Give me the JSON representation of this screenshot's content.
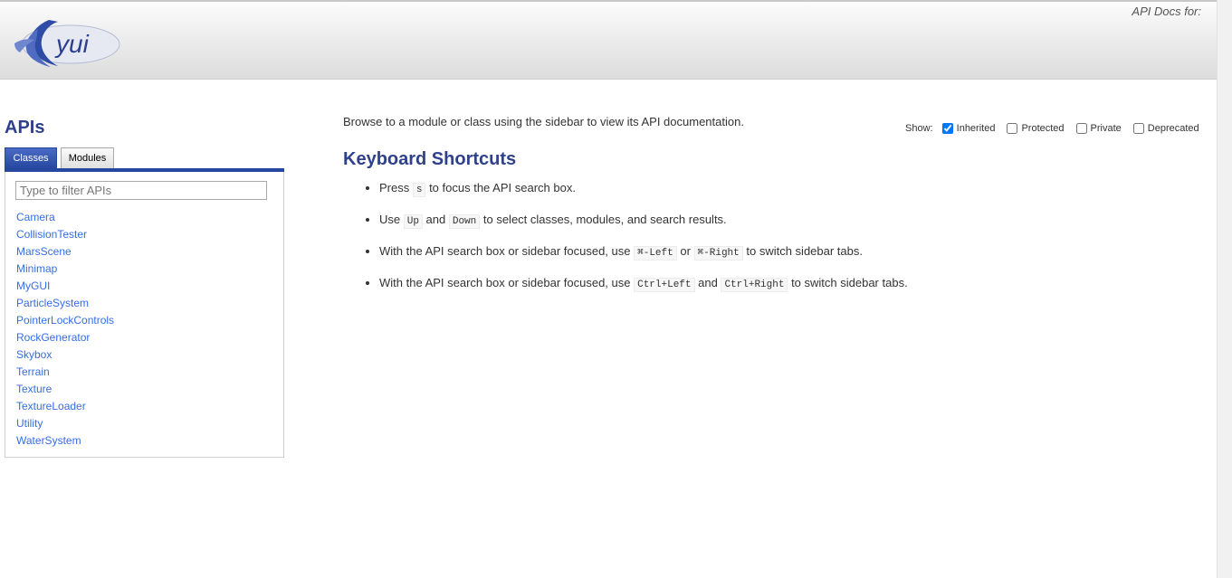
{
  "header": {
    "logo_text": "yui",
    "docs_label": "API Docs for:"
  },
  "sidebar": {
    "title": "APIs",
    "tabs": [
      {
        "label": "Classes",
        "active": true
      },
      {
        "label": "Modules",
        "active": false
      }
    ],
    "filter_placeholder": "Type to filter APIs",
    "classes": [
      "Camera",
      "CollisionTester",
      "MarsScene",
      "Minimap",
      "MyGUI",
      "ParticleSystem",
      "PointerLockControls",
      "RockGenerator",
      "Skybox",
      "Terrain",
      "Texture",
      "TextureLoader",
      "Utility",
      "WaterSystem"
    ]
  },
  "main": {
    "intro": "Browse to a module or class using the sidebar to view its API documentation.",
    "options": {
      "show_label": "Show:",
      "checkboxes": [
        {
          "label": "Inherited",
          "checked": true
        },
        {
          "label": "Protected",
          "checked": false
        },
        {
          "label": "Private",
          "checked": false
        },
        {
          "label": "Deprecated",
          "checked": false
        }
      ]
    },
    "shortcuts_title": "Keyboard Shortcuts",
    "shortcuts": [
      [
        {
          "t": "text",
          "v": "Press "
        },
        {
          "t": "code",
          "v": "s"
        },
        {
          "t": "text",
          "v": " to focus the API search box."
        }
      ],
      [
        {
          "t": "text",
          "v": "Use "
        },
        {
          "t": "code",
          "v": "Up"
        },
        {
          "t": "text",
          "v": " and "
        },
        {
          "t": "code",
          "v": "Down"
        },
        {
          "t": "text",
          "v": " to select classes, modules, and search results."
        }
      ],
      [
        {
          "t": "text",
          "v": "With the API search box or sidebar focused, use "
        },
        {
          "t": "code",
          "v": "⌘-Left"
        },
        {
          "t": "text",
          "v": " or "
        },
        {
          "t": "code",
          "v": "⌘-Right"
        },
        {
          "t": "text",
          "v": " to switch sidebar tabs."
        }
      ],
      [
        {
          "t": "text",
          "v": "With the API search box or sidebar focused, use "
        },
        {
          "t": "code",
          "v": "Ctrl+Left"
        },
        {
          "t": "text",
          "v": " and "
        },
        {
          "t": "code",
          "v": "Ctrl+Right"
        },
        {
          "t": "text",
          "v": " to switch sidebar tabs."
        }
      ]
    ]
  },
  "colors": {
    "accent": "#30418c",
    "tab_active": "#2647a0",
    "link": "#356de4"
  }
}
